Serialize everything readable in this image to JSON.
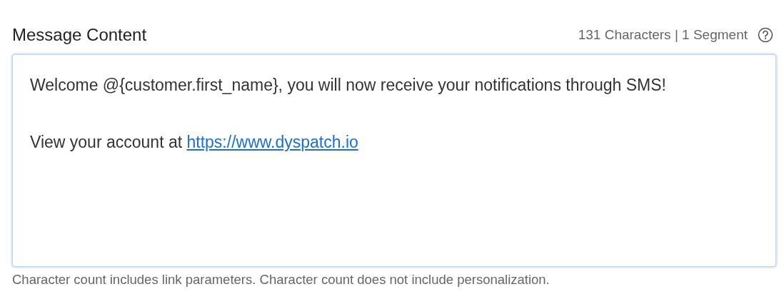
{
  "label": "Message Content",
  "counter": "131 Characters | 1 Segment",
  "message": {
    "paragraphs": [
      {
        "text": "Welcome @{customer.first_name}, you will now receive your notifications through SMS!"
      },
      {
        "text": "View your account at ",
        "link": "https://www.dyspatch.io"
      }
    ]
  },
  "hint": "Character count includes link parameters. Character count does not include personalization."
}
